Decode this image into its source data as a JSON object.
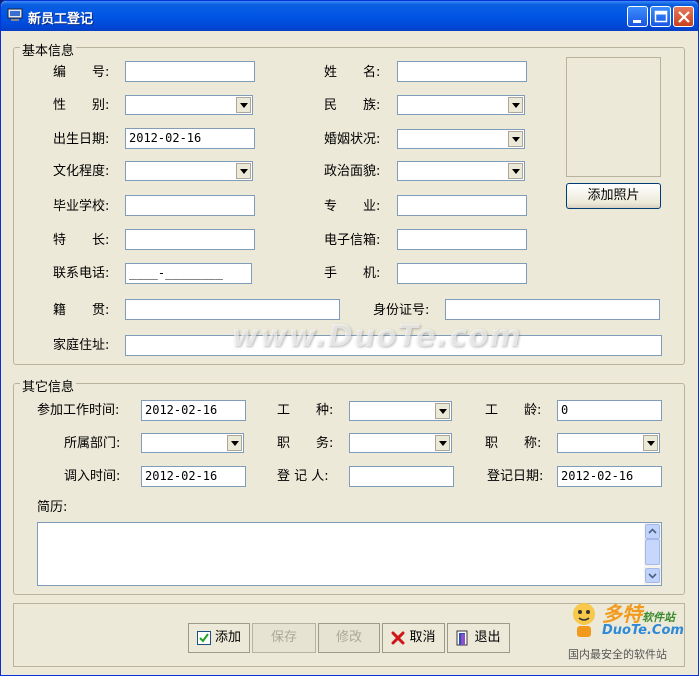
{
  "window": {
    "title": "新员工登记",
    "minimize_icon": "minimize-icon",
    "maximize_icon": "maximize-icon",
    "close_icon": "close-icon"
  },
  "basic": {
    "group_title": "基本信息",
    "id_label": "编　　号:",
    "name_label": "姓　　名:",
    "gender_label": "性　　别:",
    "ethnicity_label": "民　　族:",
    "birth_label": "出生日期:",
    "birth_value": "2012-02-16",
    "marital_label": "婚姻状况:",
    "education_label": "文化程度:",
    "political_label": "政治面貌:",
    "school_label": "毕业学校:",
    "major_label": "专　　业:",
    "specialty_label": "特　　长:",
    "email_label": "电子信箱:",
    "phone_label": "联系电话:",
    "phone_value": "____-________",
    "mobile_label": "手　　机:",
    "native_label": "籍　　贯:",
    "idcard_label": "身份证号:",
    "address_label": "家庭住址:",
    "add_photo_label": "添加照片"
  },
  "other": {
    "group_title": "其它信息",
    "join_label": "参加工作时间:",
    "join_value": "2012-02-16",
    "worktype_label": "工　　种:",
    "seniority_label": "工　　龄:",
    "seniority_value": "0",
    "dept_label": "所属部门:",
    "position_label": "职　　务:",
    "title_label": "职　　称:",
    "transfer_label": "调入时间:",
    "transfer_value": "2012-02-16",
    "registrar_label": "登 记 人:",
    "regdate_label": "登记日期:",
    "regdate_value": "2012-02-16",
    "resume_label": "简历:"
  },
  "toolbar": {
    "add_label": "添加",
    "save_label": "保存",
    "edit_label": "修改",
    "cancel_label": "取消",
    "exit_label": "退出"
  },
  "watermark": {
    "center": "www.DuoTe.com",
    "logo_main": "多特",
    "logo_sub": "软件站",
    "logo_url": "DuoTe.Com",
    "logo_slogan": "国内最安全的软件站"
  }
}
